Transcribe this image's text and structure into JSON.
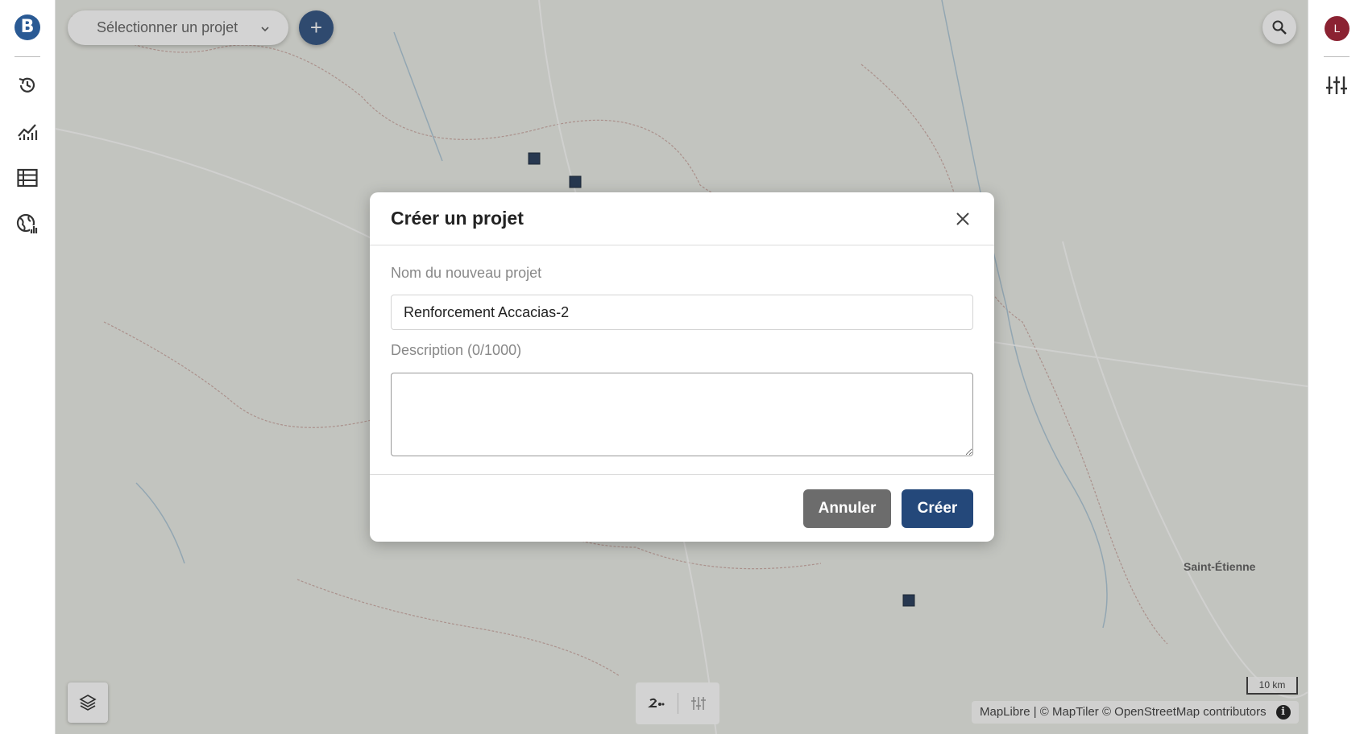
{
  "sidebar": {
    "logo": "B",
    "items": [
      {
        "icon": "history-icon"
      },
      {
        "icon": "chart-line-icon"
      },
      {
        "icon": "table-list-icon"
      },
      {
        "icon": "globe-chart-icon"
      }
    ]
  },
  "header": {
    "project_select_label": "Sélectionner un projet",
    "add_label": "+"
  },
  "user": {
    "avatar_initial": "L"
  },
  "map": {
    "city_label": "Saint-Étienne",
    "scale_label": "10 km",
    "attribution": "MapLibre | © MapTiler © OpenStreetMap contributors",
    "info": "i"
  },
  "modal": {
    "title": "Créer un projet",
    "name_label": "Nom du nouveau projet",
    "name_value": "Renforcement Accacias-2",
    "description_label": "Description (0/1000)",
    "description_value": "",
    "cancel_label": "Annuler",
    "create_label": "Créer"
  },
  "colors": {
    "primary": "#24487a",
    "cancel": "#6c6c6c",
    "avatar": "#8b2232"
  }
}
